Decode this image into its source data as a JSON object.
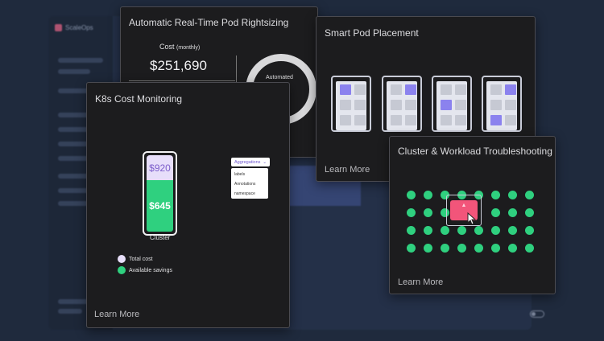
{
  "background_app": {
    "logo_text": "ScaleOps",
    "colors": {
      "background": "#1f2a3d",
      "app_bg": "#25324a"
    }
  },
  "rightsizing_card": {
    "title": "Automatic Real-Time Pod Rightsizing",
    "cost_label": "Cost",
    "cost_period": "(monthly)",
    "cost_value": "$251,690",
    "gauge_label": "Automated"
  },
  "placement_card": {
    "title": "Smart Pod Placement",
    "learn_more": "Learn More",
    "nodes": [
      {
        "pods": [
          "active",
          "idle",
          "idle",
          "idle",
          "idle",
          "idle"
        ]
      },
      {
        "pods": [
          "idle",
          "active",
          "idle",
          "idle",
          "idle",
          "idle"
        ]
      },
      {
        "pods": [
          "idle",
          "idle",
          "active",
          "idle",
          "idle",
          "idle"
        ]
      },
      {
        "pods": [
          "idle",
          "active",
          "idle",
          "idle",
          "active",
          "idle"
        ]
      }
    ],
    "colors": {
      "active_pod": "#8b82ee",
      "idle_pod": "#c6c9d3"
    }
  },
  "k8s_card": {
    "title": "K8s Cost Monitoring",
    "bar": {
      "top_value": "$920",
      "bottom_value": "$645",
      "caption": "Cluster"
    },
    "legend": [
      {
        "label": "Total cost",
        "color": "#e7defa"
      },
      {
        "label": "Available savings",
        "color": "#2fd07f"
      }
    ],
    "aggregations": {
      "label": "Aggregations",
      "options": [
        "labels",
        "Annotations",
        "namespace"
      ]
    },
    "learn_more": "Learn More"
  },
  "trouble_card": {
    "title": "Cluster & Workload Troubleshooting",
    "learn_more": "Learn More",
    "colors": {
      "healthy": "#2fd07f",
      "alert": "#f2557a"
    }
  }
}
